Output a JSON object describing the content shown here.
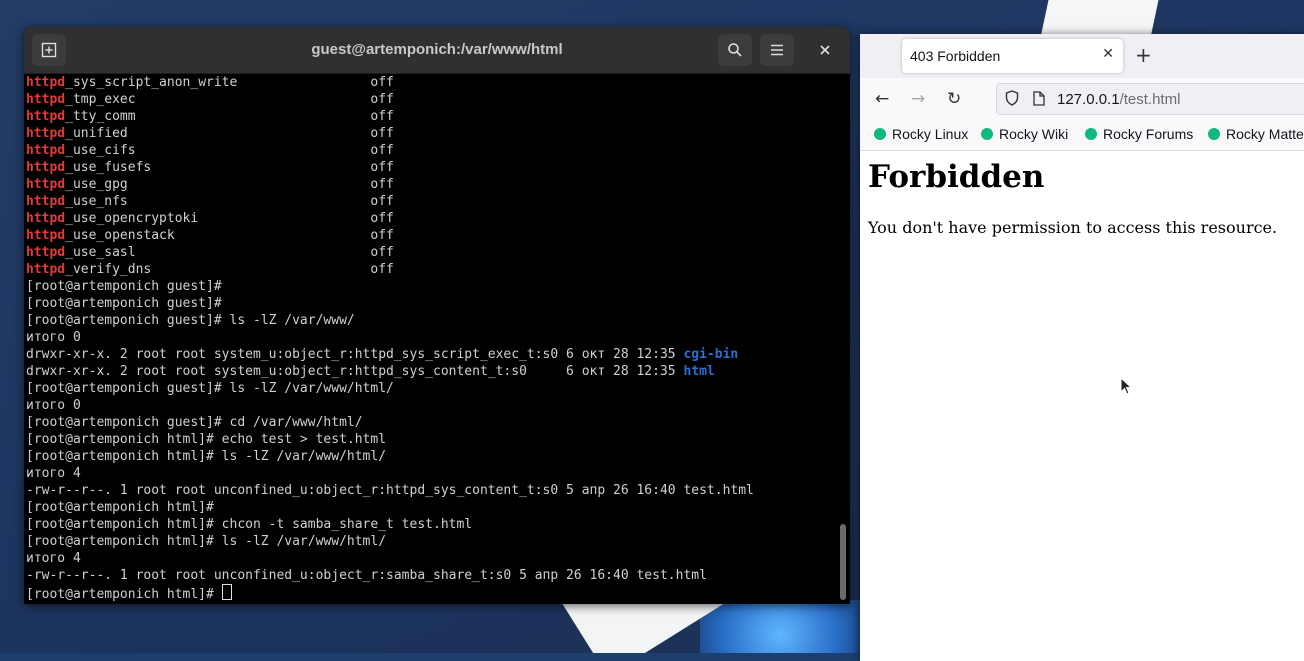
{
  "terminal": {
    "title": "guest@artemponich:/var/www/html",
    "lines": [
      {
        "red": "httpd",
        "text": "_sys_script_anon_write                 off"
      },
      {
        "red": "httpd",
        "text": "_tmp_exec                              off"
      },
      {
        "red": "httpd",
        "text": "_tty_comm                              off"
      },
      {
        "red": "httpd",
        "text": "_unified                               off"
      },
      {
        "red": "httpd",
        "text": "_use_cifs                              off"
      },
      {
        "red": "httpd",
        "text": "_use_fusefs                            off"
      },
      {
        "red": "httpd",
        "text": "_use_gpg                               off"
      },
      {
        "red": "httpd",
        "text": "_use_nfs                               off"
      },
      {
        "red": "httpd",
        "text": "_use_opencryptoki                      off"
      },
      {
        "red": "httpd",
        "text": "_use_openstack                         off"
      },
      {
        "red": "httpd",
        "text": "_use_sasl                              off"
      },
      {
        "red": "httpd",
        "text": "_verify_dns                            off"
      },
      {
        "text": "[root@artemponich guest]#"
      },
      {
        "text": "[root@artemponich guest]#"
      },
      {
        "text": "[root@artemponich guest]# ls -lZ /var/www/"
      },
      {
        "text": "итого 0"
      },
      {
        "text": "drwxr-xr-x. 2 root root system_u:object_r:httpd_sys_script_exec_t:s0 6 окт 28 12:35 ",
        "blue": "cgi-bin"
      },
      {
        "text": "drwxr-xr-x. 2 root root system_u:object_r:httpd_sys_content_t:s0     6 окт 28 12:35 ",
        "blue": "html"
      },
      {
        "text": "[root@artemponich guest]# ls -lZ /var/www/html/"
      },
      {
        "text": "итого 0"
      },
      {
        "text": "[root@artemponich guest]# cd /var/www/html/"
      },
      {
        "text": "[root@artemponich html]# echo test > test.html"
      },
      {
        "text": "[root@artemponich html]# ls -lZ /var/www/html/"
      },
      {
        "text": "итого 4"
      },
      {
        "text": "-rw-r--r--. 1 root root unconfined_u:object_r:httpd_sys_content_t:s0 5 апр 26 16:40 test.html"
      },
      {
        "text": "[root@artemponich html]#"
      },
      {
        "text": "[root@artemponich html]# chcon -t samba_share_t test.html"
      },
      {
        "text": "[root@artemponich html]# ls -lZ /var/www/html/"
      },
      {
        "text": "итого 4"
      },
      {
        "text": "-rw-r--r--. 1 root root unconfined_u:object_r:samba_share_t:s0 5 апр 26 16:40 test.html"
      },
      {
        "text": "[root@artemponich html]# ",
        "cursor": true
      }
    ],
    "icons": {
      "new_tab": "new-tab-icon",
      "search": "search-icon",
      "menu": "hamburger-menu-icon",
      "close": "close-icon"
    }
  },
  "browser": {
    "tab_title": "403 Forbidden",
    "url_host": "127.0.0.1",
    "url_path": "/test.html",
    "bookmarks": [
      "Rocky Linux",
      "Rocky Wiki",
      "Rocky Forums",
      "Rocky Matte"
    ],
    "page_heading": "Forbidden",
    "page_text": "You don't have permission to access this resource."
  },
  "colors": {
    "terminal_bg": "#000000",
    "httpd_red": "#e03a3a",
    "dir_blue": "#2b6fd0",
    "bookmark_icon": "#10b981"
  }
}
